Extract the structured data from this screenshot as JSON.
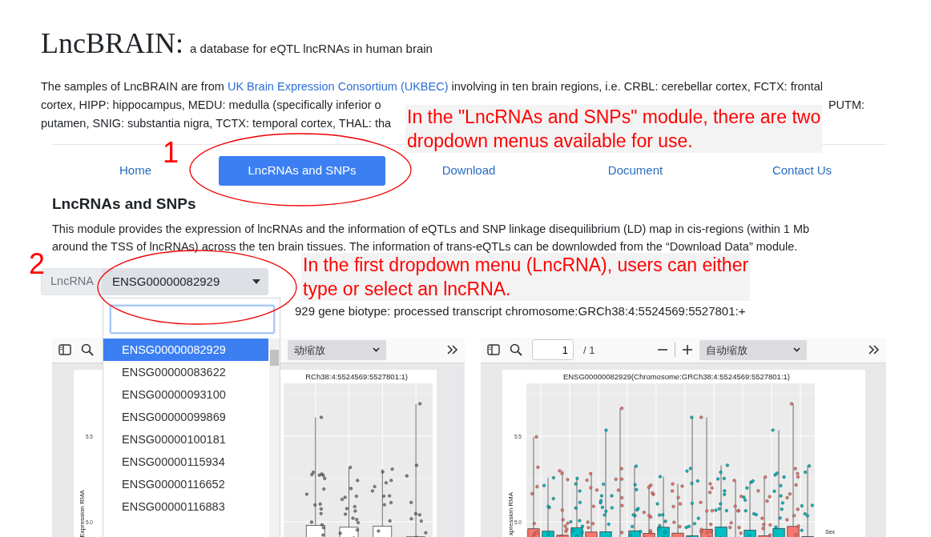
{
  "header": {
    "title": "LncBRAIN:",
    "subtitle": "a database for eQTL lncRNAs in human brain"
  },
  "intro": {
    "before_link": "The samples of LncBRAIN are from",
    "link": "UK Brain Expression Consortium (UKBEC)",
    "line_1_rest": "involving in ten brain regions, i.e. CRBL: cerebellar cortex, FCTX: frontal",
    "line_2": "cortex, HIPP: hippocampus, MEDU: medulla (specifically inferior o",
    "line_2_end": "PUTM:",
    "line_3": "putamen, SNIG: substantia nigra, TCTX: temporal cortex, THAL: tha"
  },
  "nav": [
    {
      "label": "Home",
      "selected": false
    },
    {
      "label": "LncRNAs and SNPs",
      "selected": true
    },
    {
      "label": "Download",
      "selected": false
    },
    {
      "label": "Document",
      "selected": false
    },
    {
      "label": "Contact Us",
      "selected": false
    }
  ],
  "section": {
    "title": "LncRNAs and SNPs",
    "description": "This module provides the expression of lncRNAs and the information of eQTLs and SNP linkage disequilibrium (LD) map in cis-regions (within 1 Mb\naround the TSS of lncRNAs) across the ten brain tissues. The information of trans-eQTLs can be downlowded from the “Download Data” module."
  },
  "selector": {
    "label": "LncRNA",
    "value": "ENSG00000082929",
    "options": [
      {
        "label": "ENSG00000082929",
        "selected": true
      },
      {
        "label": "ENSG00000083622",
        "selected": false
      },
      {
        "label": "ENSG00000093100",
        "selected": false
      },
      {
        "label": "ENSG00000099869",
        "selected": false
      },
      {
        "label": "ENSG00000100181",
        "selected": false
      },
      {
        "label": "ENSG00000115934",
        "selected": false
      },
      {
        "label": "ENSG00000116652",
        "selected": false
      },
      {
        "label": "ENSG00000116883",
        "selected": false
      }
    ]
  },
  "info_line": "929 gene biotype: processed transcript chromosome:GRCh38:4:5524569:5527801:+",
  "viewers": [
    {
      "kind": "plain",
      "zoom_select": "动缩放",
      "plot_title": "RCh38:4:5524569:5527801:1)",
      "yticks": [
        "5.5",
        "5.0"
      ],
      "ylabel": "Expression RMA"
    },
    {
      "kind": "by-sex",
      "page_input": "1",
      "page_count": "/ 1",
      "zoom_select": "自动缩放",
      "plot_title": "ENSG00000082929(Chromosome:GRCh38:4:5524569:5527801:1)",
      "yticks": [
        "5.5",
        "5.0"
      ],
      "ylabel": "xpression RMA",
      "legend_title": "Sex"
    }
  ],
  "annotations": [
    {
      "marker": "1",
      "note": "In the \"LncRNAs and SNPs\" module, there are two\ndropdown menus available for use."
    },
    {
      "marker": "2",
      "note": "In the first dropdown menu (LncRNA), users can either\ntype or select an lncRNA."
    }
  ]
}
